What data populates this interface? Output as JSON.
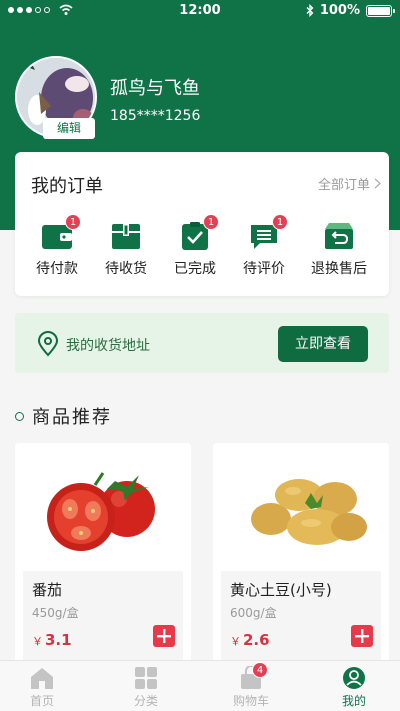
{
  "status_bar": {
    "time": "12:00",
    "battery": "100%"
  },
  "profile": {
    "username": "孤鸟与飞鱼",
    "phone": "185****1256",
    "edit_label": "编辑"
  },
  "orders": {
    "title": "我的订单",
    "all_label": "全部订单",
    "items": [
      {
        "label": "待付款",
        "icon": "wallet-icon",
        "badge": "1"
      },
      {
        "label": "待收货",
        "icon": "package-icon",
        "badge": ""
      },
      {
        "label": "已完成",
        "icon": "check-clipboard-icon",
        "badge": "1"
      },
      {
        "label": "待评价",
        "icon": "comment-icon",
        "badge": "1"
      },
      {
        "label": "退换售后",
        "icon": "return-box-icon",
        "badge": ""
      }
    ]
  },
  "address": {
    "text": "我的收货地址",
    "button": "立即查看"
  },
  "recommend": {
    "title": "商品推荐",
    "products": [
      {
        "name": "番茄",
        "weight": "450g/盒",
        "currency": "￥",
        "price": "3.1"
      },
      {
        "name": "黄心土豆(小号)",
        "weight": "600g/盒",
        "currency": "￥",
        "price": "2.6"
      }
    ]
  },
  "tabbar": {
    "items": [
      {
        "label": "首页",
        "icon": "home-icon",
        "badge": ""
      },
      {
        "label": "分类",
        "icon": "grid-icon",
        "badge": ""
      },
      {
        "label": "购物车",
        "icon": "shopping-bag-icon",
        "badge": "4"
      },
      {
        "label": "我的",
        "icon": "user-icon",
        "badge": ""
      }
    ],
    "active": "我的"
  },
  "colors": {
    "brand": "#107348",
    "price": "#d9313f",
    "badge": "#e34055",
    "banner": "#e6f3e7"
  }
}
